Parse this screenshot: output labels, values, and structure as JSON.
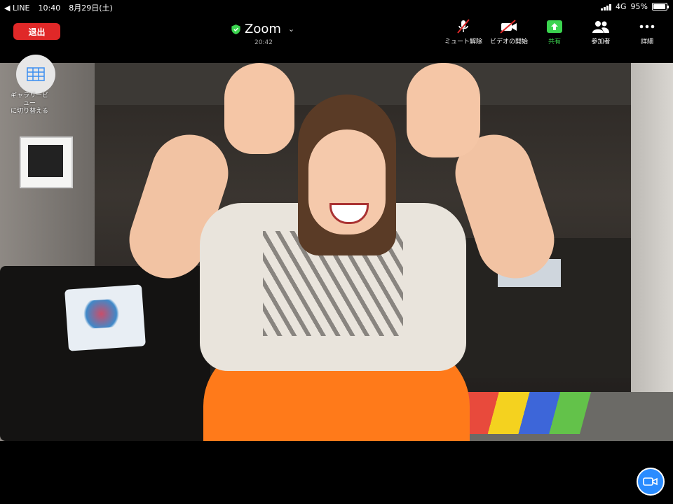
{
  "status_bar": {
    "carrier": "◀ LINE",
    "time": "10:40",
    "date": "8月29日(土)",
    "network": "4G",
    "battery": "95%"
  },
  "toolbar": {
    "leave_label": "退出",
    "title": "Zoom",
    "timer": "20:42",
    "buttons": {
      "unmute": "ミュート解除",
      "start_video": "ビデオの開始",
      "share": "共有",
      "participants": "参加者",
      "more": "詳細"
    }
  },
  "gallery": {
    "label_line1": "ギャラリービ",
    "label_line2": "ュー",
    "label_line3": "に切り替える"
  },
  "colors": {
    "leave": "#e02828",
    "share_green": "#3bd44f",
    "shield_green": "#3bd44f",
    "fab_blue": "#2a8cff"
  },
  "icons": [
    "shield-icon",
    "mic-muted-icon",
    "video-muted-icon",
    "share-up-arrow-icon",
    "participants-icon",
    "more-dots-icon",
    "gallery-grid-icon",
    "camera-icon",
    "signal-icon",
    "battery-icon",
    "chevron-down-icon"
  ]
}
